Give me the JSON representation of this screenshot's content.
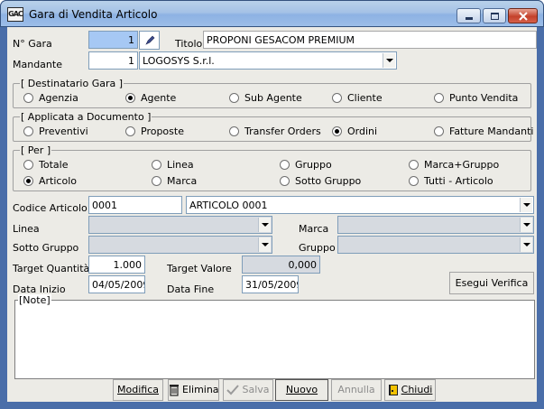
{
  "window": {
    "title": "Gara di Vendita Articolo",
    "app_icon_text": "GAC"
  },
  "header": {
    "ngara_label": "N° Gara",
    "ngara_value": "1",
    "titolo_label": "Titolo",
    "titolo_value": "PROPONI GESACOM PREMIUM",
    "mandante_label": "Mandante",
    "mandante_code": "1",
    "mandante_name": "LOGOSYS S.r.l."
  },
  "destinatario": {
    "title": "[ Destinatario Gara ]",
    "options": [
      "Agenzia",
      "Agente",
      "Sub Agente",
      "Cliente",
      "Punto Vendita"
    ],
    "selected": "Agente"
  },
  "applicata": {
    "title": "[ Applicata a Documento ]",
    "options": [
      "Preventivi",
      "Proposte",
      "Transfer Orders",
      "Ordini",
      "Fatture Mandanti"
    ],
    "selected": "Ordini"
  },
  "per": {
    "title": "[ Per ]",
    "options": [
      "Totale",
      "Linea",
      "Gruppo",
      "Marca+Gruppo",
      "Articolo",
      "Marca",
      "Sotto Gruppo",
      "Tutti - Articolo"
    ],
    "selected": "Articolo"
  },
  "articolo": {
    "label": "Codice Articolo",
    "code": "0001",
    "description": "ARTICOLO 0001"
  },
  "filters": {
    "linea_label": "Linea",
    "marca_label": "Marca",
    "sottogruppo_label": "Sotto Gruppo",
    "gruppo_label": "Gruppo"
  },
  "target": {
    "quantita_label": "Target Quantità",
    "quantita_value": "1.000",
    "valore_label": "Target Valore",
    "valore_value": "0,000"
  },
  "dates": {
    "inizio_label": "Data Inizio",
    "inizio_value": "04/05/2009",
    "fine_label": "Data Fine",
    "fine_value": "31/05/2009",
    "verify_button": "Esegui Verifica"
  },
  "notes": {
    "title": "[Note]",
    "value": ""
  },
  "toolbar": {
    "modifica": "Modifica",
    "elimina": "Elimina",
    "salva": "Salva",
    "nuovo": "Nuovo",
    "annulla": "Annulla",
    "chiudi": "Chiudi"
  }
}
